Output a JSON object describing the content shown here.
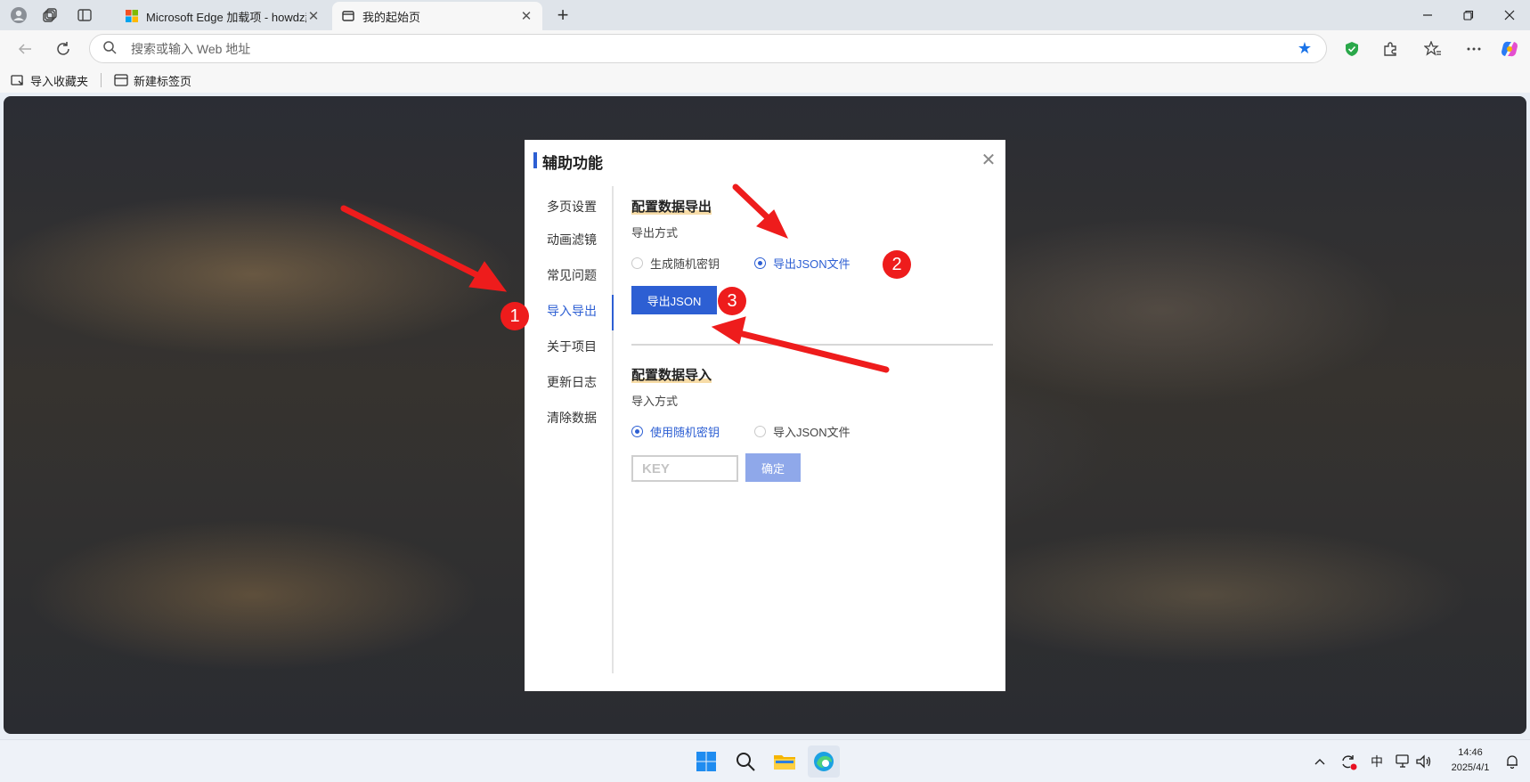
{
  "browser": {
    "tabs": [
      {
        "title": "Microsoft Edge 加载项 - howdz起"
      },
      {
        "title": "我的起始页"
      }
    ],
    "address_placeholder": "搜索或输入 Web 地址",
    "favorites": [
      {
        "label": "导入收藏夹"
      },
      {
        "label": "新建标签页"
      }
    ]
  },
  "dialog": {
    "title": "辅助功能",
    "nav": [
      {
        "label": "多页设置"
      },
      {
        "label": "动画滤镜"
      },
      {
        "label": "常见问题"
      },
      {
        "label": "导入导出"
      },
      {
        "label": "关于项目"
      },
      {
        "label": "更新日志"
      },
      {
        "label": "清除数据"
      }
    ],
    "active_nav": "导入导出",
    "export": {
      "title": "配置数据导出",
      "method_label": "导出方式",
      "options": [
        "生成随机密钥",
        "导出JSON文件"
      ],
      "selected": "导出JSON文件",
      "button_label": "导出JSON"
    },
    "import": {
      "title": "配置数据导入",
      "method_label": "导入方式",
      "options": [
        "使用随机密钥",
        "导入JSON文件"
      ],
      "selected": "使用随机密钥",
      "key_placeholder": "KEY",
      "confirm_label": "确定"
    }
  },
  "annotations": {
    "badges": [
      "1",
      "2",
      "3"
    ],
    "color": "#ee1c1c"
  },
  "taskbar": {
    "ime_label": "中",
    "time": "14:46",
    "date": "2025/4/1"
  },
  "colors": {
    "accent": "#2d5fd3",
    "confirm_disabled": "#8fa8ea",
    "annotation_red": "#ee1c1c"
  }
}
